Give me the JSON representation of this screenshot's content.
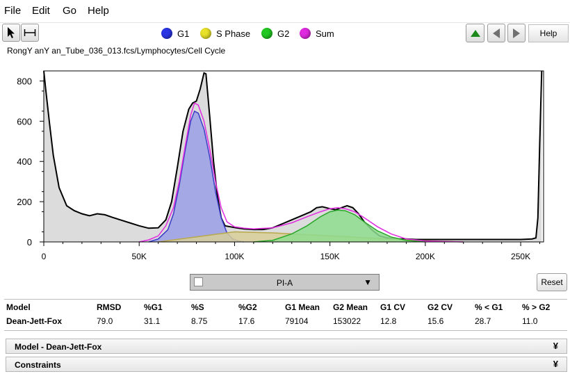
{
  "menu": [
    "File",
    "Edit",
    "Go",
    "Help"
  ],
  "toolbar": {
    "pointer_icon": "arrow-pointer-icon",
    "range_icon": "range-gate-icon",
    "up_icon": "triangle-up-icon",
    "prev_icon": "triangle-left-icon",
    "next_icon": "triangle-right-icon",
    "help_label": "Help"
  },
  "legend": [
    {
      "label": "G1",
      "color": "#2a35e6"
    },
    {
      "label": "S Phase",
      "color": "#e8e22a"
    },
    {
      "label": "G2",
      "color": "#22c922"
    },
    {
      "label": "Sum",
      "color": "#e02ae0"
    }
  ],
  "file_path": "RongY anY an_Tube_036_013.fcs/Lymphocytes/Cell Cycle",
  "chart_data": {
    "type": "area",
    "title": "",
    "xlabel": "PI-A",
    "ylabel": "",
    "xlim": [
      0,
      262000
    ],
    "ylim": [
      0,
      850
    ],
    "x_ticks": [
      0,
      50000,
      100000,
      150000,
      200000,
      250000
    ],
    "x_tick_labels": [
      "0",
      "50K",
      "100K",
      "150K",
      "200K",
      "250K"
    ],
    "y_ticks": [
      0,
      200,
      400,
      600,
      800
    ],
    "y_tick_labels": [
      "0",
      "200",
      "400",
      "600",
      "800"
    ],
    "grid": false,
    "series": [
      {
        "name": "Data",
        "color": "#000000",
        "fill": "#dcdcdc",
        "x": [
          0,
          1000,
          3000,
          5000,
          8000,
          12000,
          16000,
          20000,
          24000,
          28000,
          32000,
          36000,
          40000,
          45000,
          50000,
          55000,
          60000,
          64000,
          67000,
          70000,
          73000,
          76000,
          78000,
          80000,
          82000,
          84000,
          85000,
          87000,
          89000,
          91000,
          93000,
          95000,
          98000,
          101000,
          105000,
          110000,
          115000,
          120000,
          125000,
          130000,
          135000,
          140000,
          143000,
          146000,
          150000,
          153000,
          156000,
          159000,
          162000,
          165000,
          168000,
          172000,
          176000,
          180000,
          185000,
          190000,
          195000,
          200000,
          210000,
          220000,
          230000,
          240000,
          250000,
          256000,
          258000,
          259000,
          260000,
          261000
        ],
        "y": [
          850,
          760,
          590,
          430,
          270,
          180,
          155,
          140,
          130,
          140,
          135,
          122,
          110,
          95,
          80,
          68,
          70,
          110,
          200,
          370,
          550,
          660,
          690,
          700,
          760,
          840,
          835,
          620,
          400,
          230,
          120,
          80,
          75,
          70,
          65,
          62,
          62,
          70,
          90,
          110,
          130,
          150,
          170,
          175,
          165,
          160,
          170,
          180,
          170,
          140,
          100,
          60,
          30,
          20,
          15,
          15,
          12,
          12,
          12,
          12,
          12,
          12,
          12,
          15,
          20,
          120,
          500,
          850
        ]
      },
      {
        "name": "G1",
        "color": "#3a3ac8",
        "fill": "#9aa0e8",
        "x": [
          55000,
          60000,
          65000,
          68000,
          71000,
          74000,
          77000,
          79000,
          81000,
          84000,
          87000,
          90000,
          93000,
          96000,
          99000,
          102000,
          105000
        ],
        "y": [
          0,
          15,
          60,
          140,
          280,
          450,
          600,
          650,
          640,
          560,
          420,
          250,
          120,
          45,
          15,
          5,
          0
        ]
      },
      {
        "name": "S Phase",
        "color": "#b8a84a",
        "fill": "#d8cf9a",
        "x": [
          60000,
          80000,
          100000,
          120000,
          140000,
          160000,
          180000,
          200000,
          220000
        ],
        "y": [
          0,
          25,
          50,
          45,
          35,
          25,
          15,
          6,
          0
        ]
      },
      {
        "name": "G2",
        "color": "#2aa82a",
        "fill": "#8edc8e",
        "x": [
          110000,
          120000,
          130000,
          138000,
          145000,
          150000,
          154000,
          158000,
          163000,
          168000,
          175000,
          182000,
          190000,
          200000
        ],
        "y": [
          0,
          8,
          40,
          80,
          125,
          150,
          158,
          155,
          135,
          100,
          55,
          25,
          8,
          0
        ]
      },
      {
        "name": "Sum",
        "color": "#e02ae0",
        "fill": "none",
        "x": [
          50000,
          55000,
          60000,
          64000,
          68000,
          71000,
          74000,
          77000,
          79000,
          81000,
          84000,
          87000,
          90000,
          93000,
          96000,
          100000,
          105000,
          110000,
          120000,
          130000,
          138000,
          145000,
          150000,
          154000,
          158000,
          163000,
          168000,
          175000,
          182000,
          190000,
          200000,
          210000,
          220000
        ],
        "y": [
          0,
          10,
          30,
          80,
          170,
          300,
          470,
          630,
          690,
          680,
          600,
          460,
          300,
          170,
          100,
          75,
          68,
          65,
          70,
          95,
          125,
          150,
          165,
          170,
          165,
          150,
          120,
          75,
          40,
          15,
          5,
          2,
          0
        ]
      }
    ]
  },
  "param_select": {
    "value": "PI-A",
    "arrow": "▼"
  },
  "reset_label": "Reset",
  "results": {
    "headers": [
      "Model",
      "RMSD",
      "%G1",
      "%S",
      "%G2",
      "G1 Mean",
      "G2 Mean",
      "G1 CV",
      "G2 CV",
      "% < G1",
      "% > G2"
    ],
    "values": [
      "Dean-Jett-Fox",
      "79.0",
      "31.1",
      "8.75",
      "17.6",
      "79104",
      "153022",
      "12.8",
      "15.6",
      "28.7",
      "11.0"
    ]
  },
  "panels": [
    {
      "title": "Model  -  Dean-Jett-Fox",
      "chevron": "¥"
    },
    {
      "title": "Constraints",
      "chevron": "¥"
    }
  ]
}
